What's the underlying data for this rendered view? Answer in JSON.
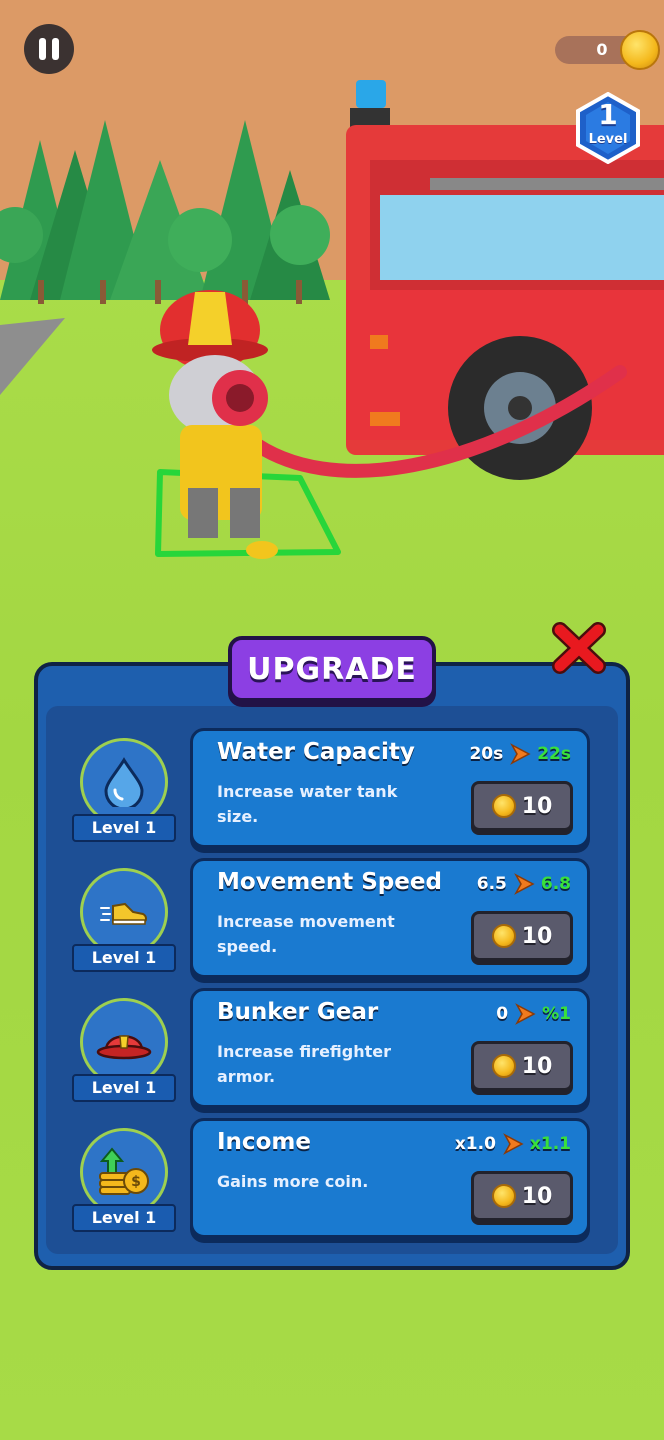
{
  "hud": {
    "coins": "0",
    "level_number": "1",
    "level_label": "Level"
  },
  "panel": {
    "title": "UPGRADE"
  },
  "upgrades": [
    {
      "name": "Water Capacity",
      "description": "Increase water tank size.",
      "level": "Level 1",
      "current": "20s",
      "next": "22s",
      "price": "10",
      "icon": "water-drop-icon"
    },
    {
      "name": "Movement Speed",
      "description": "Increase movement speed.",
      "level": "Level 1",
      "current": "6.5",
      "next": "6.8",
      "price": "10",
      "icon": "sneaker-icon"
    },
    {
      "name": "Bunker Gear",
      "description": "Increase firefighter armor.",
      "level": "Level 1",
      "current": "0",
      "next": "%1",
      "price": "10",
      "icon": "firefighter-helmet-icon"
    },
    {
      "name": "Income",
      "description": "Gains more coin.",
      "level": "Level 1",
      "current": "x1.0",
      "next": "x1.1",
      "price": "10",
      "icon": "coin-stack-icon"
    }
  ],
  "colors": {
    "sky": "#dc9a66",
    "grass": "#a6d94a",
    "panel": "#1e5fae",
    "card": "#1a7ad0",
    "title_tab": "#8c3fe3",
    "stat_next": "#39e03b",
    "close": "#e8191f"
  }
}
